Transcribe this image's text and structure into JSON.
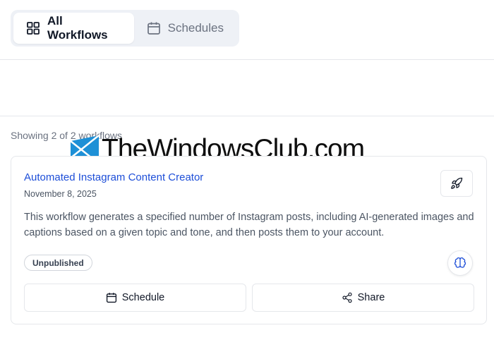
{
  "tabs": [
    {
      "label": "All Workflows",
      "icon": "grid-icon",
      "active": true
    },
    {
      "label": "Schedules",
      "icon": "calendar-icon",
      "active": false
    }
  ],
  "list": {
    "showing_text": "Showing 2 of 2 workflows"
  },
  "watermark": {
    "text": "TheWindowsClub.com"
  },
  "workflow_card": {
    "title": "Automated Instagram Content Creator",
    "date": "November 8, 2025",
    "description": "This workflow generates a specified number of Instagram posts, including AI-generated images and captions based on a given topic and tone, and then posts them to your account.",
    "status": "Unpublished",
    "schedule_label": "Schedule",
    "share_label": "Share",
    "deploy_icon": "rocket-icon",
    "ai_icon": "brain-icon"
  },
  "colors": {
    "accent": "#1d4ed8",
    "tab_bg": "#eef1f6",
    "border": "#e5e7eb"
  }
}
